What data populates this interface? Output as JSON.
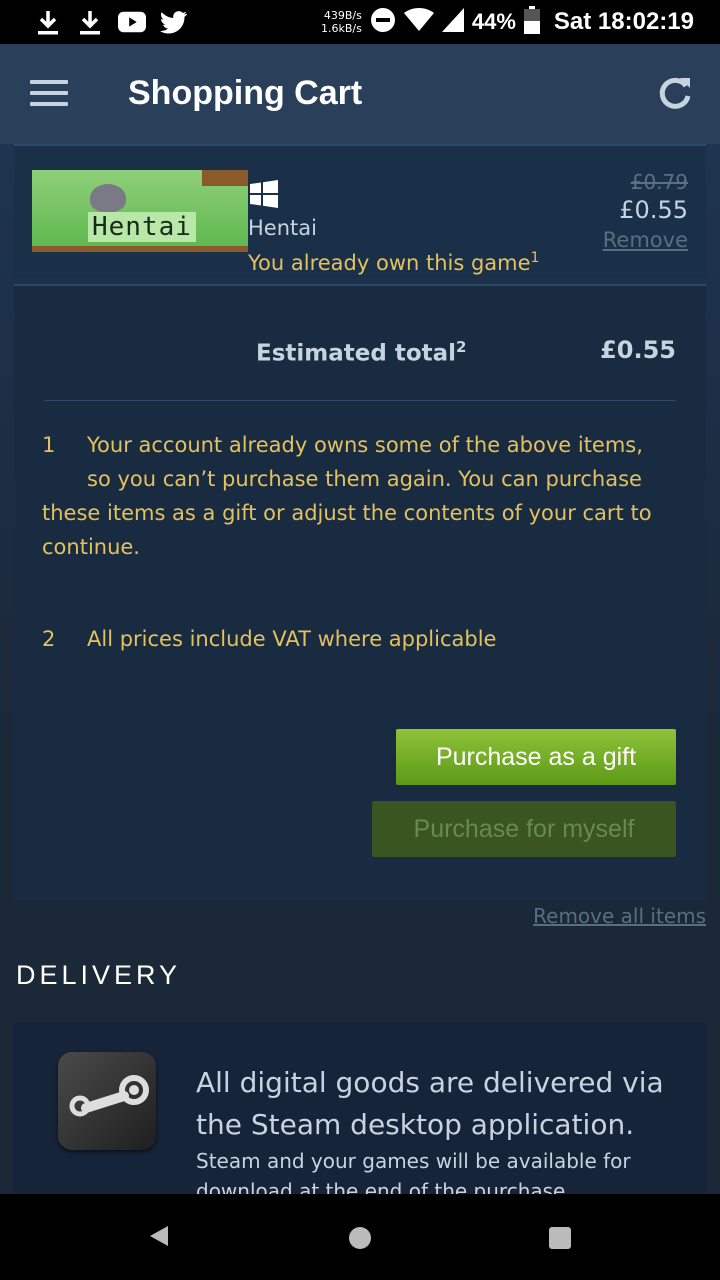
{
  "status_bar": {
    "net_up": "439B/s",
    "net_down": "1.6kB/s",
    "battery": "44%",
    "time": "Sat 18:02:19",
    "icons": [
      "download-icon",
      "download-icon",
      "youtube-icon",
      "twitter-icon",
      "dnd-icon",
      "wifi-icon",
      "signal-icon",
      "battery-icon"
    ]
  },
  "app_bar": {
    "title": "Shopping Cart"
  },
  "cart_items": [
    {
      "thumb_text": "Hentai",
      "platform": "windows",
      "name": "Hentai",
      "notice": "You already own this game",
      "notice_footnote": "1",
      "original_price": "£0.79",
      "final_price": "£0.55",
      "remove_label": "Remove"
    }
  ],
  "summary": {
    "estimated_label": "Estimated total",
    "estimated_footnote": "2",
    "estimated_value": "£0.55",
    "notes": [
      {
        "num": "1",
        "first": "Your account already owns some of the above items,",
        "rest_a": "so you can’t purchase them again. You can purchase",
        "rest_b": "these items as a gift or adjust the contents of your cart to continue."
      },
      {
        "num": "2",
        "text": "All prices include VAT where applicable"
      }
    ],
    "gift_button": "Purchase as a gift",
    "myself_button": "Purchase for myself"
  },
  "remove_all": "Remove all items",
  "delivery": {
    "heading": "DELIVERY",
    "title": "All digital goods are delivered via the Steam desktop application.",
    "subtitle": "Steam and your games will be available for download at the end of the purchase"
  }
}
